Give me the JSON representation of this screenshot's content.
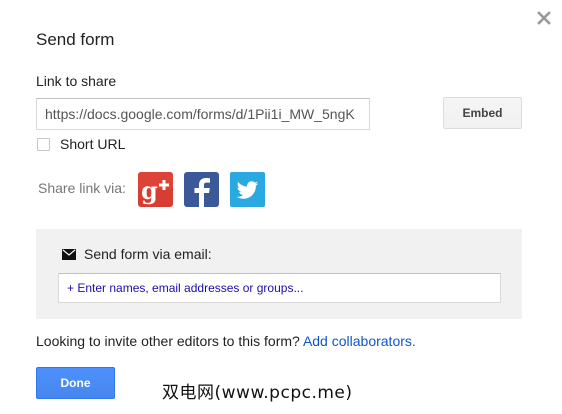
{
  "dialog": {
    "title": "Send form",
    "close_icon": "close-icon"
  },
  "link": {
    "label": "Link to share",
    "url": "https://docs.google.com/forms/d/1Pii1i_MW_5ngK",
    "embed_label": "Embed",
    "short_url_label": "Short URL",
    "short_url_checked": false
  },
  "share": {
    "label": "Share link via:",
    "services": [
      {
        "name": "Google+",
        "icon": "google-plus-icon",
        "color": "#d73d32"
      },
      {
        "name": "Facebook",
        "icon": "facebook-icon",
        "color": "#3b5998"
      },
      {
        "name": "Twitter",
        "icon": "twitter-icon",
        "color": "#2aa9e0"
      }
    ]
  },
  "email": {
    "label": "Send form via email:",
    "icon": "envelope-icon",
    "placeholder": "+ Enter names, email addresses or groups..."
  },
  "invite": {
    "text": "Looking to invite other editors to this form?",
    "link": "Add collaborators."
  },
  "footer": {
    "done_label": "Done"
  },
  "watermark": {
    "text": "双电网(www.pcpc.me)"
  },
  "colors": {
    "primary_button": "#4d90fe",
    "link": "#1155cc",
    "panel_bg": "#f1f1f1"
  }
}
